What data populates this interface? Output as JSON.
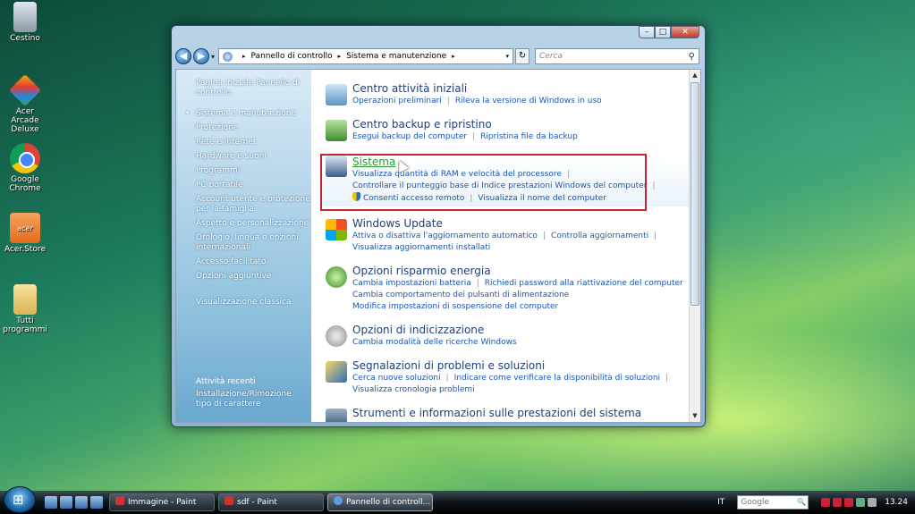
{
  "desktop": {
    "icons": [
      {
        "label": "Cestino"
      },
      {
        "label": "Acer Arcade Deluxe"
      },
      {
        "label": "Google Chrome"
      },
      {
        "label": "Acer.Store"
      },
      {
        "label": "Tutti programmi"
      }
    ]
  },
  "window": {
    "controls": {
      "minimize": "–",
      "maximize": "□",
      "close": "✕"
    },
    "address": {
      "crumbs": [
        "Pannello di controllo",
        "Sistema e manutenzione"
      ],
      "separator": "▸"
    },
    "search_placeholder": "Cerca",
    "sidebar": {
      "home": "Pagina iniziale Pannello di controllo",
      "items": [
        {
          "label": "Sistema e manutenzione"
        },
        {
          "label": "Protezione"
        },
        {
          "label": "Rete e Internet"
        },
        {
          "label": "Hardware e suoni"
        },
        {
          "label": "Programmi"
        },
        {
          "label": "PC portatile"
        },
        {
          "label": "Account utente e protezione per la famiglia"
        },
        {
          "label": "Aspetto e personalizzazione"
        },
        {
          "label": "Orologio, lingua e opzioni internazionali"
        },
        {
          "label": "Accesso facilitato"
        },
        {
          "label": "Opzioni aggiuntive"
        }
      ],
      "classic": "Visualizzazione classica",
      "recent_heading": "Attività recenti",
      "recent_item": "Installazione/Rimozione tipo di carattere"
    },
    "categories": [
      {
        "title": "Centro attività iniziali",
        "lines": [
          [
            "Operazioni preliminari",
            "Rileva la versione di Windows in uso"
          ]
        ]
      },
      {
        "title": "Centro backup e ripristino",
        "lines": [
          [
            "Esegui backup del computer",
            "Ripristina file da backup"
          ]
        ]
      },
      {
        "title": "Sistema",
        "lines": [
          [
            "Visualizza quantità di RAM e velocità del processore"
          ],
          [
            "Controllare il punteggio base di Indice prestazioni Windows del computer"
          ],
          [
            "Consenti accesso remoto",
            "Visualizza il nome del computer"
          ]
        ]
      },
      {
        "title": "Windows Update",
        "lines": [
          [
            "Attiva o disattiva l'aggiornamento automatico",
            "Controlla aggiornamenti"
          ],
          [
            "Visualizza aggiornamenti installati"
          ]
        ]
      },
      {
        "title": "Opzioni risparmio energia",
        "lines": [
          [
            "Cambia impostazioni batteria",
            "Richiedi password alla riattivazione del computer"
          ],
          [
            "Cambia comportamento dei pulsanti di alimentazione"
          ],
          [
            "Modifica impostazioni di sospensione del computer"
          ]
        ]
      },
      {
        "title": "Opzioni di indicizzazione",
        "lines": [
          [
            "Cambia modalità delle ricerche Windows"
          ]
        ]
      },
      {
        "title": "Segnalazioni di problemi e soluzioni",
        "lines": [
          [
            "Cerca nuove soluzioni",
            "Indicare come verificare la disponibilità di soluzioni"
          ],
          [
            "Visualizza cronologia problemi"
          ]
        ]
      },
      {
        "title": "Strumenti e informazioni sulle prestazioni del sistema",
        "lines": []
      }
    ]
  },
  "taskbar": {
    "tasks": [
      {
        "label": "Immagine - Paint"
      },
      {
        "label": "sdf - Paint"
      },
      {
        "label": "Pannello di controll..."
      }
    ],
    "language": "IT",
    "search_text": "Google",
    "clock": "13.24"
  },
  "colors": {
    "highlight_frame": "#c0272d",
    "link": "#1c55b3",
    "category_title": "#1e3f7a",
    "hovered_title": "#2d9a2d"
  }
}
